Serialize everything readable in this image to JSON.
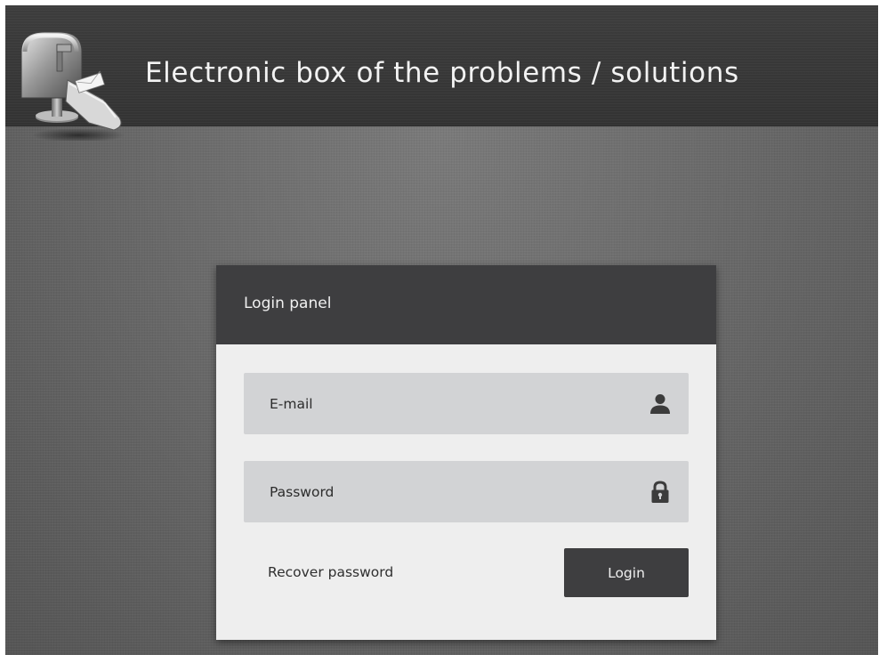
{
  "header": {
    "title": "Electronic box of the problems / solutions",
    "logo_icon": "mailbox-icon"
  },
  "login_panel": {
    "title": "Login panel",
    "email": {
      "label": "E-mail",
      "icon": "user-icon"
    },
    "password": {
      "label": "Password",
      "icon": "lock-icon"
    },
    "recover_link": "Recover password",
    "login_button": "Login"
  },
  "colors": {
    "header_bg": "#3a3a3a",
    "page_bg": "#6b6b6b",
    "panel_bg": "#eeeeee",
    "panel_header_bg": "#3e3e40",
    "field_bg": "#d2d3d5",
    "button_bg": "#3e3e40",
    "title_text": "#f2f2f2"
  }
}
